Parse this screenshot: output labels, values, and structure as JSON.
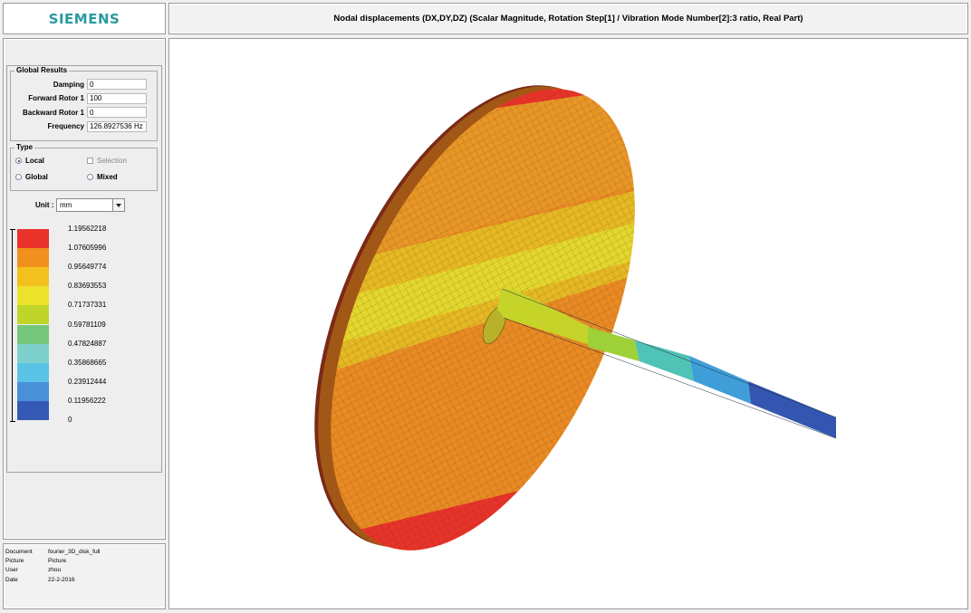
{
  "header": {
    "logo": "SIEMENS",
    "title": "Nodal displacements (DX,DY,DZ) (Scalar Magnitude, Rotation Step[1] / Vibration Mode Number[2]:3 ratio, Real Part)"
  },
  "global_results": {
    "title": "Global Results",
    "fields": [
      {
        "label": "Damping",
        "value": "0"
      },
      {
        "label": "Forward Rotor 1",
        "value": "100"
      },
      {
        "label": "Backward Rotor 1",
        "value": "0"
      },
      {
        "label": "Frequency",
        "value": "126.8927536 Hz"
      }
    ]
  },
  "type": {
    "title": "Type",
    "options": [
      {
        "label": "Local",
        "selected": true
      },
      {
        "label": "Selection",
        "disabled": true
      },
      {
        "label": "Global",
        "selected": false
      },
      {
        "label": "Mixed",
        "selected": false
      }
    ]
  },
  "unit": {
    "label": "Unit :",
    "value": "mm"
  },
  "legend": {
    "values": [
      "1.19562218",
      "1.07605996",
      "0.95649774",
      "0.83693553",
      "0.71737331",
      "0.59781109",
      "0.47824887",
      "0.35868665",
      "0.23912444",
      "0.11956222",
      "0"
    ],
    "colors": [
      "#e8322a",
      "#f0901e",
      "#f2c11e",
      "#ece22a",
      "#bfd52a",
      "#76c77c",
      "#7ed0cc",
      "#5bc4e6",
      "#4a90d9",
      "#3659b6"
    ]
  },
  "meta": [
    {
      "key": "Document",
      "value": "fourier_3D_disk_full"
    },
    {
      "key": "Picture",
      "value": "Picture"
    },
    {
      "key": "User",
      "value": "zhou"
    },
    {
      "key": "Date",
      "value": "22-2-2016"
    }
  ]
}
